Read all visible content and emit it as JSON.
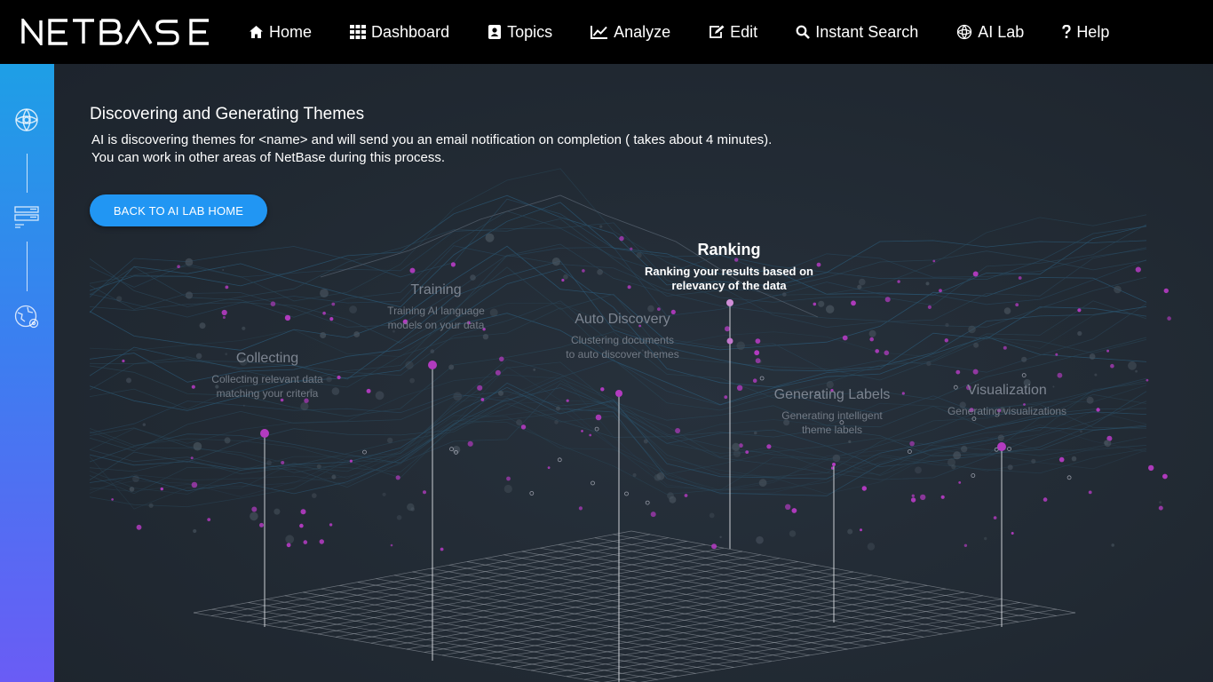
{
  "nav": {
    "brand": "NETBASE",
    "items": [
      {
        "label": "Home",
        "icon": "home-icon"
      },
      {
        "label": "Dashboard",
        "icon": "grid-icon"
      },
      {
        "label": "Topics",
        "icon": "contact-book-icon"
      },
      {
        "label": "Analyze",
        "icon": "line-chart-icon"
      },
      {
        "label": "Edit",
        "icon": "edit-icon"
      },
      {
        "label": "Instant Search",
        "icon": "search-icon"
      },
      {
        "label": "AI Lab",
        "icon": "ai-brain-icon"
      },
      {
        "label": "Help",
        "icon": "question-icon"
      }
    ]
  },
  "sidebar": {
    "icons": [
      "ai-lab-icon",
      "theme-list-icon",
      "globe-settings-icon"
    ]
  },
  "main": {
    "title": "Discovering and Generating Themes",
    "description_line1": "AI is discovering themes for <name> and will send you an email notification on completion ( takes about 4 minutes).",
    "description_line2": "You can work in other areas of NetBase during this process.",
    "back_button": "BACK TO AI LAB HOME"
  },
  "stages": [
    {
      "title": "Collecting",
      "desc1": "Collecting relevant data",
      "desc2": "matching your criteria",
      "active": false
    },
    {
      "title": "Training",
      "desc1": "Training AI language",
      "desc2": "models on your data",
      "active": false
    },
    {
      "title": "Auto Discovery",
      "desc1": "Clustering documents",
      "desc2": "to auto discover themes",
      "active": false
    },
    {
      "title": "Ranking",
      "desc1": "Ranking your results based on",
      "desc2": "relevancy of the data",
      "active": true
    },
    {
      "title": "Generating Labels",
      "desc1": "Generating intelligent",
      "desc2": "theme labels",
      "active": false
    },
    {
      "title": "Visualization",
      "desc1": "Generating visualizations",
      "desc2": "",
      "active": false
    }
  ],
  "colors": {
    "topbar": "#000000",
    "accent": "#2196f3",
    "background": "#232b35",
    "dots": "#b23bc0",
    "rail_top": "#1e9fe6",
    "rail_bottom": "#6a5cf5"
  }
}
